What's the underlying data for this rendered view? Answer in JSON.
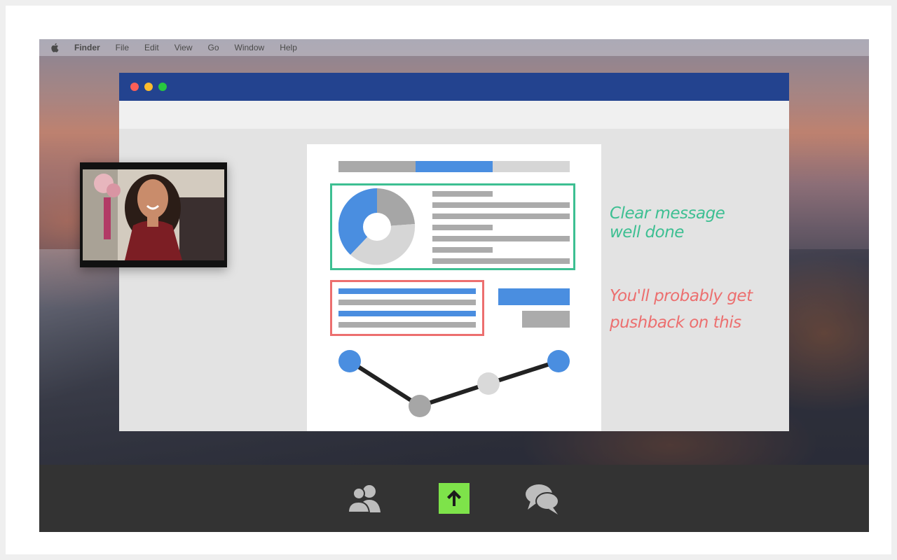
{
  "menubar": {
    "app_name": "Finder",
    "items": [
      "File",
      "Edit",
      "View",
      "Go",
      "Window",
      "Help"
    ]
  },
  "annotations": {
    "good_line1": "Clear message",
    "good_line2": "well done",
    "bad_line1": "You'll probably get",
    "bad_line2": "pushback on this"
  },
  "colors": {
    "window_titlebar": "#23438f",
    "highlight_good": "#3dbf92",
    "highlight_bad": "#ec6f6f",
    "accent_blue": "#4a8ee0",
    "share_button": "#7ee34a"
  },
  "icons": {
    "apple": "apple-icon",
    "participants": "participants-icon",
    "share": "share-screen-icon",
    "chat": "chat-icon"
  }
}
